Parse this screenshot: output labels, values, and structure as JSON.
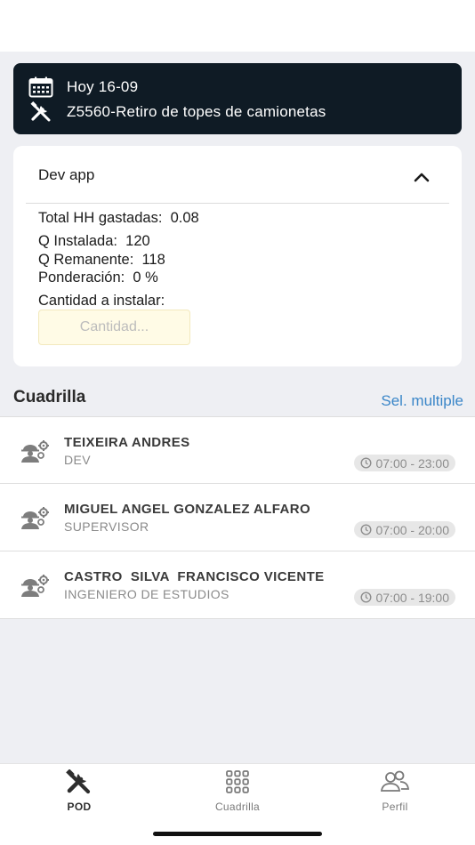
{
  "header": {
    "date_label": "Hoy 16-09",
    "task_label": "Z5560-Retiro de topes de camionetas"
  },
  "task": {
    "title": "Dev app",
    "total_hh_label": "Total HH gastadas:  0.08",
    "q_instalada_label": "Q Instalada:  120",
    "q_remanente_label": "Q Remanente:  118",
    "ponderacion_label": "Ponderación:  0 %",
    "cantidad_label": "Cantidad a instalar:",
    "cantidad_placeholder": "Cantidad..."
  },
  "crew": {
    "title": "Cuadrilla",
    "select_multiple_label": "Sel. multiple",
    "members": [
      {
        "name": "TEIXEIRA ANDRES",
        "role": "DEV",
        "schedule": "07:00 - 23:00"
      },
      {
        "name": "MIGUEL ANGEL GONZALEZ ALFARO",
        "role": "SUPERVISOR",
        "schedule": "07:00 - 20:00"
      },
      {
        "name": "CASTRO  SILVA  FRANCISCO VICENTE",
        "role": "INGENIERO DE ESTUDIOS",
        "schedule": "07:00 - 19:00"
      }
    ]
  },
  "tabbar": {
    "tabs": [
      {
        "label": "POD",
        "icon": "tools-icon",
        "active": true
      },
      {
        "label": "Cuadrilla",
        "icon": "grid-icon",
        "active": false
      },
      {
        "label": "Perfil",
        "icon": "users-icon",
        "active": false
      }
    ]
  },
  "colors": {
    "header_bg": "#0f1b25",
    "accent_link": "#3a86c8",
    "page_bg": "#eeeff3",
    "input_bg": "#fffbe6"
  }
}
